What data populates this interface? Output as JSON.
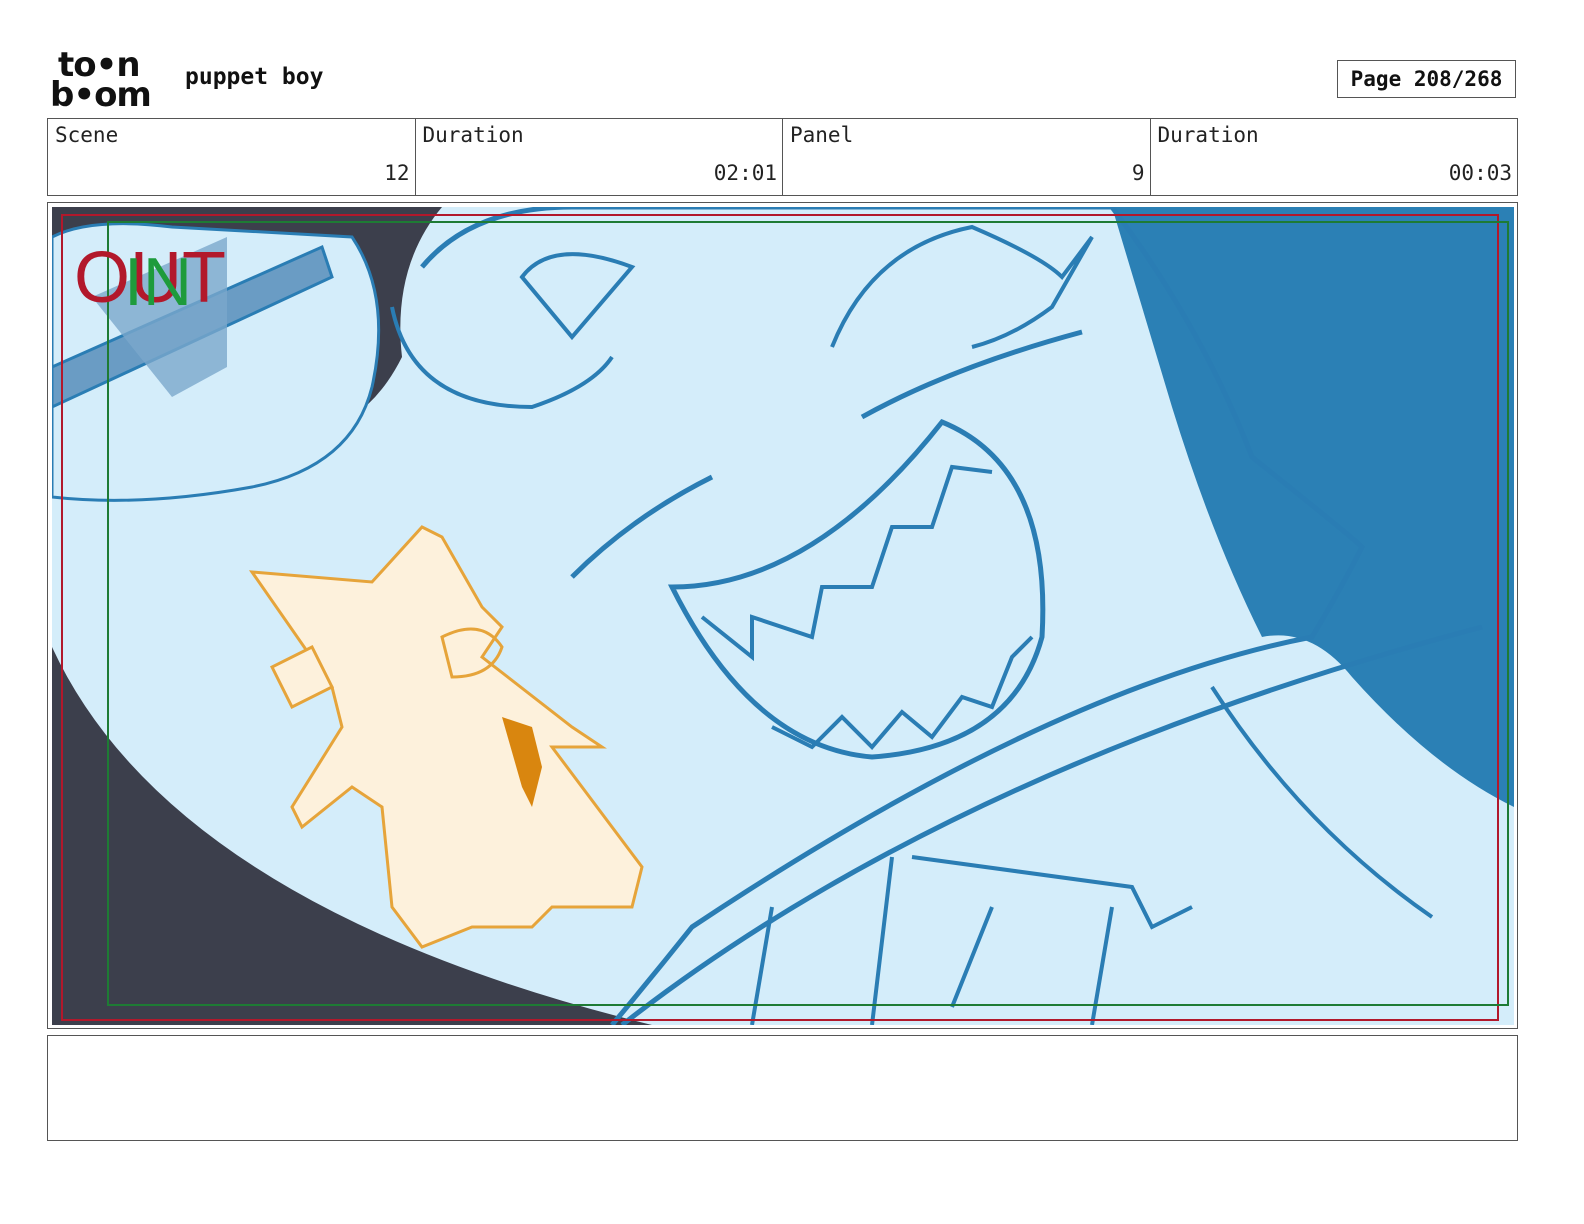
{
  "header": {
    "logo": {
      "line1": "to•n",
      "line2": "b•om"
    },
    "project_title": "puppet boy",
    "page_label": "Page 208/268"
  },
  "info": {
    "scene_label": "Scene",
    "scene_value": "12",
    "scene_duration_label": "Duration",
    "scene_duration_value": "02:01",
    "panel_label": "Panel",
    "panel_value": "9",
    "panel_duration_label": "Duration",
    "panel_duration_value": "00:03"
  },
  "panel": {
    "camera_in_label": "IN",
    "camera_out_label": "OUT",
    "colors": {
      "sky": "#d4edfa",
      "line": "#2a7db4",
      "fill_dark": "#2b80b5",
      "shadow": "#3c3f4c",
      "orange": "#e6a43a",
      "frame_out": "#b2182b",
      "frame_in": "#1e7b34"
    }
  },
  "notes": {
    "text": ""
  }
}
